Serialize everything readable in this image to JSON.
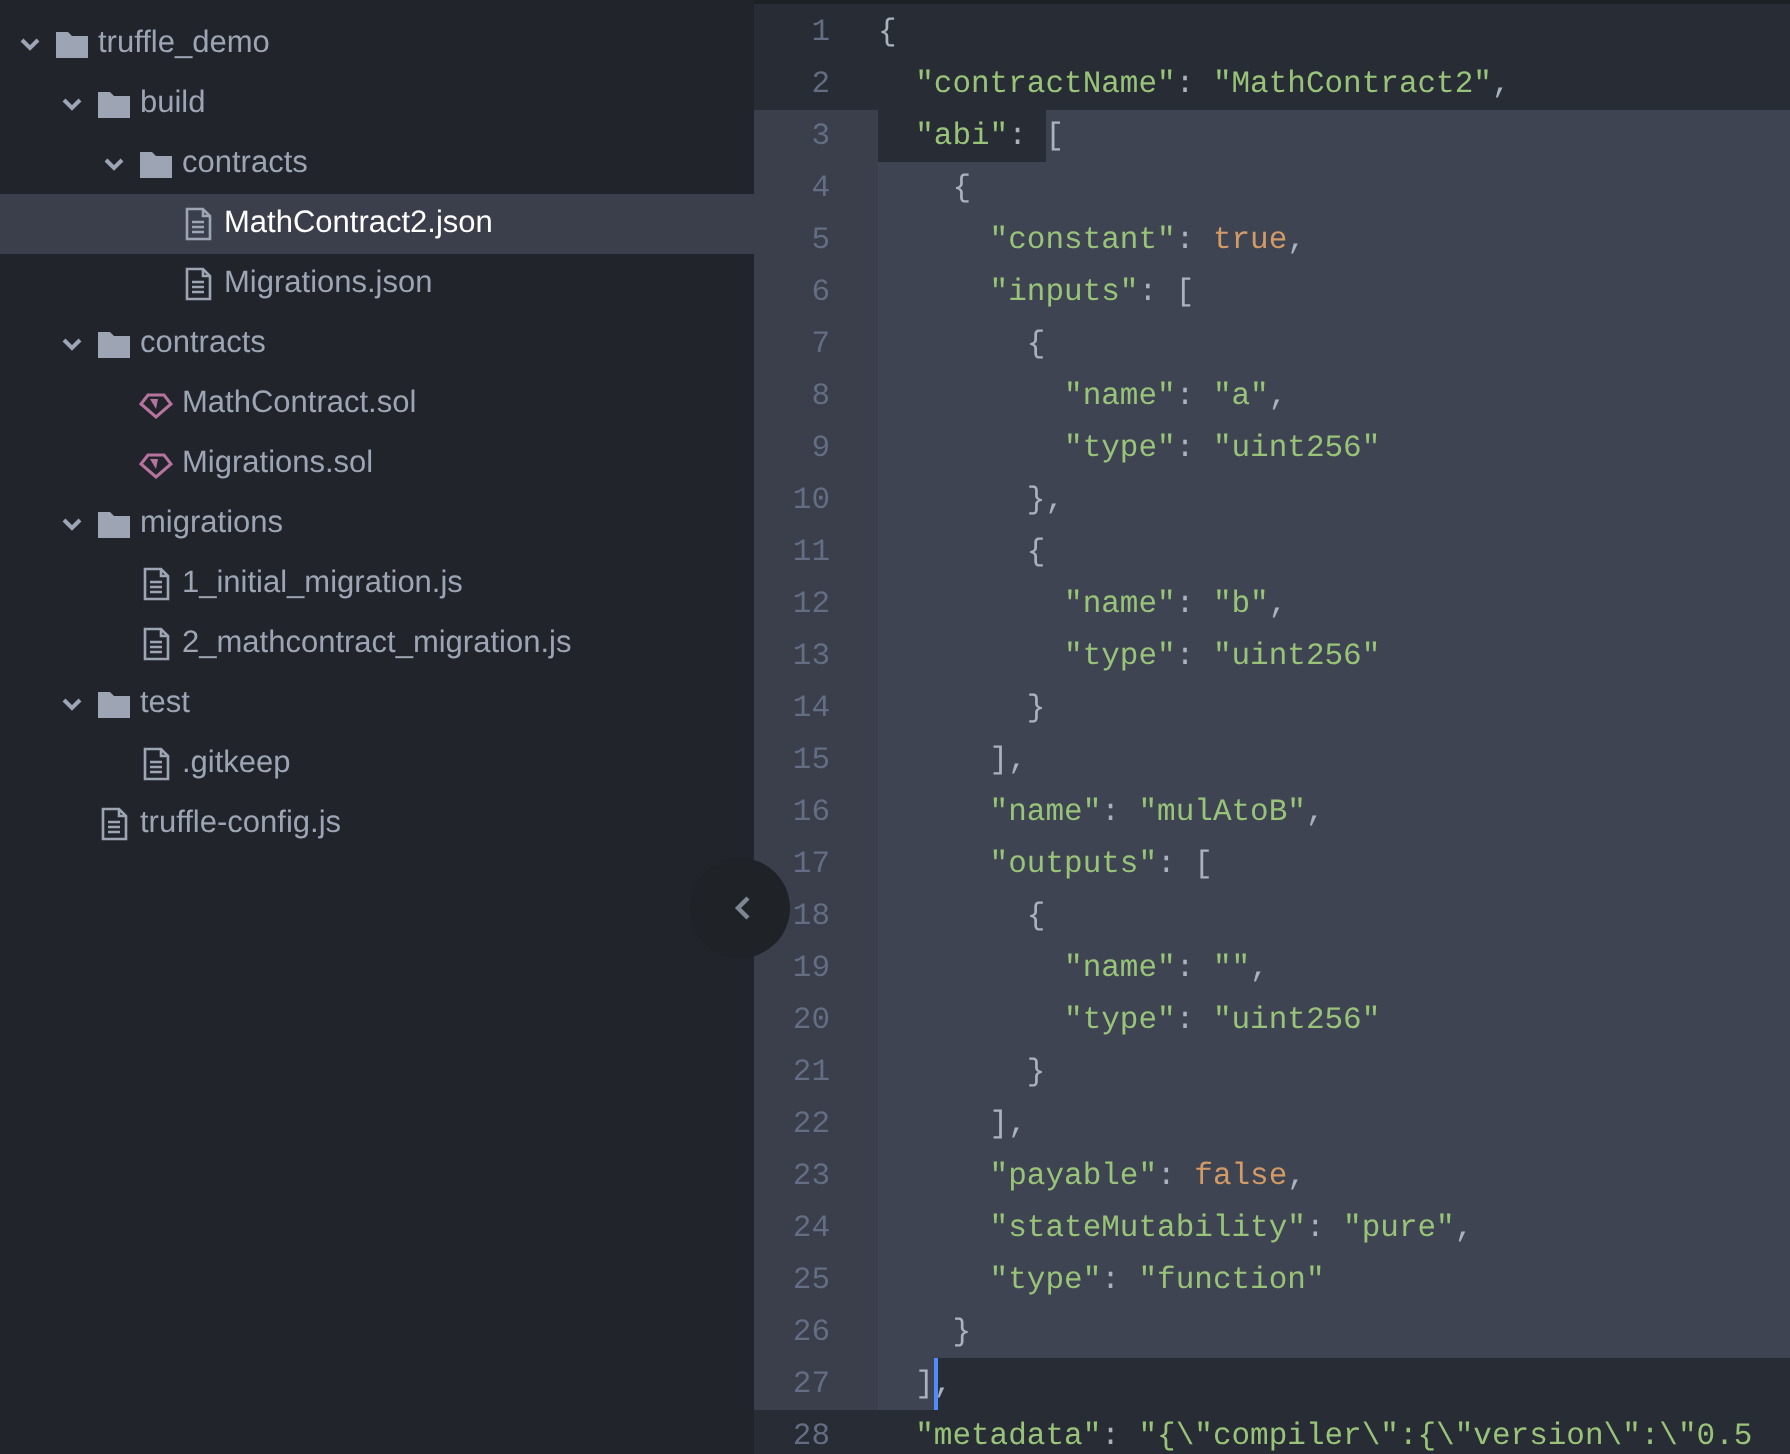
{
  "tree": [
    {
      "label": "truffle_demo",
      "kind": "folder",
      "expanded": true,
      "selected": false,
      "children": [
        {
          "label": "build",
          "kind": "folder",
          "expanded": true,
          "selected": false,
          "children": [
            {
              "label": "contracts",
              "kind": "folder",
              "expanded": true,
              "selected": false,
              "children": [
                {
                  "label": "MathContract2.json",
                  "kind": "file",
                  "selected": true
                },
                {
                  "label": "Migrations.json",
                  "kind": "file",
                  "selected": false
                }
              ]
            }
          ]
        },
        {
          "label": "contracts",
          "kind": "folder",
          "expanded": true,
          "selected": false,
          "children": [
            {
              "label": "MathContract.sol",
              "kind": "solidity",
              "selected": false
            },
            {
              "label": "Migrations.sol",
              "kind": "solidity",
              "selected": false
            }
          ]
        },
        {
          "label": "migrations",
          "kind": "folder",
          "expanded": true,
          "selected": false,
          "children": [
            {
              "label": "1_initial_migration.js",
              "kind": "file",
              "selected": false
            },
            {
              "label": "2_mathcontract_migration.js",
              "kind": "file",
              "selected": false
            }
          ]
        },
        {
          "label": "test",
          "kind": "folder",
          "expanded": true,
          "selected": false,
          "children": [
            {
              "label": ".gitkeep",
              "kind": "file",
              "selected": false
            }
          ]
        },
        {
          "label": "truffle-config.js",
          "kind": "file",
          "selected": false
        }
      ]
    }
  ],
  "editor": {
    "lines": [
      {
        "number": "1",
        "selected": false,
        "caret": false,
        "tokens": [
          {
            "text": "{",
            "kind": "punct",
            "selected": false
          }
        ]
      },
      {
        "number": "2",
        "selected": false,
        "caret": false,
        "tokens": [
          {
            "text": "  \"contractName\"",
            "kind": "key",
            "selected": false
          },
          {
            "text": ": ",
            "kind": "punct",
            "selected": false
          },
          {
            "text": "\"MathContract2\"",
            "kind": "string",
            "selected": false
          },
          {
            "text": ",",
            "kind": "punct",
            "selected": false
          }
        ]
      },
      {
        "number": "3",
        "selected": true,
        "caret": false,
        "tokens": [
          {
            "text": "  \"abi\"",
            "kind": "key",
            "selected": false
          },
          {
            "text": ": ",
            "kind": "punct",
            "selected": false
          },
          {
            "text": "[",
            "kind": "punct",
            "selected": true
          }
        ]
      },
      {
        "number": "4",
        "selected": true,
        "caret": false,
        "tokens": [
          {
            "text": "    {",
            "kind": "punct",
            "selected": true
          }
        ]
      },
      {
        "number": "5",
        "selected": true,
        "caret": false,
        "tokens": [
          {
            "text": "      \"constant\"",
            "kind": "key",
            "selected": true
          },
          {
            "text": ": ",
            "kind": "punct",
            "selected": true
          },
          {
            "text": "true",
            "kind": "literal",
            "selected": true
          },
          {
            "text": ",",
            "kind": "punct",
            "selected": true
          }
        ]
      },
      {
        "number": "6",
        "selected": true,
        "caret": false,
        "tokens": [
          {
            "text": "      \"inputs\"",
            "kind": "key",
            "selected": true
          },
          {
            "text": ": [",
            "kind": "punct",
            "selected": true
          }
        ]
      },
      {
        "number": "7",
        "selected": true,
        "caret": false,
        "tokens": [
          {
            "text": "        {",
            "kind": "punct",
            "selected": true
          }
        ]
      },
      {
        "number": "8",
        "selected": true,
        "caret": false,
        "tokens": [
          {
            "text": "          \"name\"",
            "kind": "key",
            "selected": true
          },
          {
            "text": ": ",
            "kind": "punct",
            "selected": true
          },
          {
            "text": "\"a\"",
            "kind": "string",
            "selected": true
          },
          {
            "text": ",",
            "kind": "punct",
            "selected": true
          }
        ]
      },
      {
        "number": "9",
        "selected": true,
        "caret": false,
        "tokens": [
          {
            "text": "          \"type\"",
            "kind": "key",
            "selected": true
          },
          {
            "text": ": ",
            "kind": "punct",
            "selected": true
          },
          {
            "text": "\"uint256\"",
            "kind": "string",
            "selected": true
          }
        ]
      },
      {
        "number": "10",
        "selected": true,
        "caret": false,
        "tokens": [
          {
            "text": "        },",
            "kind": "punct",
            "selected": true
          }
        ]
      },
      {
        "number": "11",
        "selected": true,
        "caret": false,
        "tokens": [
          {
            "text": "        {",
            "kind": "punct",
            "selected": true
          }
        ]
      },
      {
        "number": "12",
        "selected": true,
        "caret": false,
        "tokens": [
          {
            "text": "          \"name\"",
            "kind": "key",
            "selected": true
          },
          {
            "text": ": ",
            "kind": "punct",
            "selected": true
          },
          {
            "text": "\"b\"",
            "kind": "string",
            "selected": true
          },
          {
            "text": ",",
            "kind": "punct",
            "selected": true
          }
        ]
      },
      {
        "number": "13",
        "selected": true,
        "caret": false,
        "tokens": [
          {
            "text": "          \"type\"",
            "kind": "key",
            "selected": true
          },
          {
            "text": ": ",
            "kind": "punct",
            "selected": true
          },
          {
            "text": "\"uint256\"",
            "kind": "string",
            "selected": true
          }
        ]
      },
      {
        "number": "14",
        "selected": true,
        "caret": false,
        "tokens": [
          {
            "text": "        }",
            "kind": "punct",
            "selected": true
          }
        ]
      },
      {
        "number": "15",
        "selected": true,
        "caret": false,
        "tokens": [
          {
            "text": "      ],",
            "kind": "punct",
            "selected": true
          }
        ]
      },
      {
        "number": "16",
        "selected": true,
        "caret": false,
        "tokens": [
          {
            "text": "      \"name\"",
            "kind": "key",
            "selected": true
          },
          {
            "text": ": ",
            "kind": "punct",
            "selected": true
          },
          {
            "text": "\"mulAtoB\"",
            "kind": "string",
            "selected": true
          },
          {
            "text": ",",
            "kind": "punct",
            "selected": true
          }
        ]
      },
      {
        "number": "17",
        "selected": true,
        "caret": false,
        "tokens": [
          {
            "text": "      \"outputs\"",
            "kind": "key",
            "selected": true
          },
          {
            "text": ": [",
            "kind": "punct",
            "selected": true
          }
        ]
      },
      {
        "number": "18",
        "selected": true,
        "caret": false,
        "tokens": [
          {
            "text": "        {",
            "kind": "punct",
            "selected": true
          }
        ]
      },
      {
        "number": "19",
        "selected": true,
        "caret": false,
        "tokens": [
          {
            "text": "          \"name\"",
            "kind": "key",
            "selected": true
          },
          {
            "text": ": ",
            "kind": "punct",
            "selected": true
          },
          {
            "text": "\"\"",
            "kind": "string",
            "selected": true
          },
          {
            "text": ",",
            "kind": "punct",
            "selected": true
          }
        ]
      },
      {
        "number": "20",
        "selected": true,
        "caret": false,
        "tokens": [
          {
            "text": "          \"type\"",
            "kind": "key",
            "selected": true
          },
          {
            "text": ": ",
            "kind": "punct",
            "selected": true
          },
          {
            "text": "\"uint256\"",
            "kind": "string",
            "selected": true
          }
        ]
      },
      {
        "number": "21",
        "selected": true,
        "caret": false,
        "tokens": [
          {
            "text": "        }",
            "kind": "punct",
            "selected": true
          }
        ]
      },
      {
        "number": "22",
        "selected": true,
        "caret": false,
        "tokens": [
          {
            "text": "      ],",
            "kind": "punct",
            "selected": true
          }
        ]
      },
      {
        "number": "23",
        "selected": true,
        "caret": false,
        "tokens": [
          {
            "text": "      \"payable\"",
            "kind": "key",
            "selected": true
          },
          {
            "text": ": ",
            "kind": "punct",
            "selected": true
          },
          {
            "text": "false",
            "kind": "literal",
            "selected": true
          },
          {
            "text": ",",
            "kind": "punct",
            "selected": true
          }
        ]
      },
      {
        "number": "24",
        "selected": true,
        "caret": false,
        "tokens": [
          {
            "text": "      \"stateMutability\"",
            "kind": "key",
            "selected": true
          },
          {
            "text": ": ",
            "kind": "punct",
            "selected": true
          },
          {
            "text": "\"pure\"",
            "kind": "string",
            "selected": true
          },
          {
            "text": ",",
            "kind": "punct",
            "selected": true
          }
        ]
      },
      {
        "number": "25",
        "selected": true,
        "caret": false,
        "tokens": [
          {
            "text": "      \"type\"",
            "kind": "key",
            "selected": true
          },
          {
            "text": ": ",
            "kind": "punct",
            "selected": true
          },
          {
            "text": "\"function\"",
            "kind": "string",
            "selected": true
          }
        ]
      },
      {
        "number": "26",
        "selected": true,
        "caret": false,
        "tokens": [
          {
            "text": "    }",
            "kind": "punct",
            "selected": true
          }
        ]
      },
      {
        "number": "27",
        "selected": true,
        "caret": true,
        "tokens": [
          {
            "text": "  ]",
            "kind": "punct",
            "selected": true
          },
          {
            "text": ",",
            "kind": "punct",
            "selected": false
          }
        ]
      },
      {
        "number": "28",
        "selected": false,
        "caret": false,
        "tokens": [
          {
            "text": "  \"metadata\"",
            "kind": "key",
            "selected": false
          },
          {
            "text": ": ",
            "kind": "punct",
            "selected": false
          },
          {
            "text": "\"{\\\"compiler\\\":{\\\"version\\\":\\\"0.5",
            "kind": "string",
            "selected": false
          }
        ]
      }
    ]
  }
}
